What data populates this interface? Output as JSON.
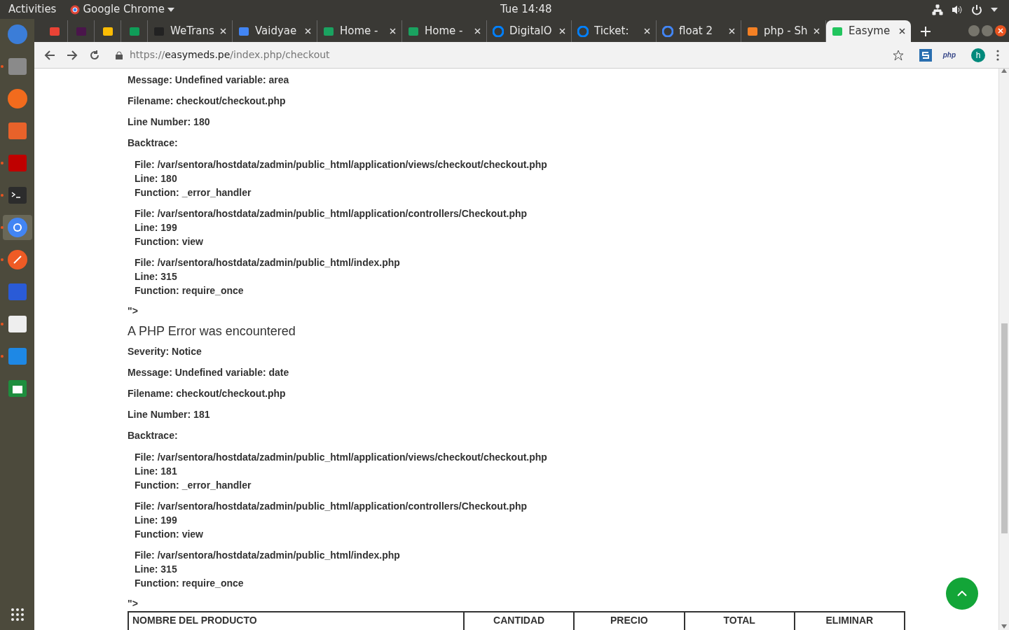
{
  "topbar": {
    "activities": "Activities",
    "app": "Google Chrome",
    "clock": "Tue 14:48"
  },
  "dock": [
    {
      "kind": "mail",
      "running": false,
      "selected": false
    },
    {
      "kind": "files",
      "running": true,
      "selected": false
    },
    {
      "kind": "firefox",
      "running": false,
      "selected": false
    },
    {
      "kind": "store",
      "running": false,
      "selected": false
    },
    {
      "kind": "filezilla",
      "running": true,
      "selected": false
    },
    {
      "kind": "terminal",
      "running": true,
      "selected": false
    },
    {
      "kind": "chrome",
      "running": true,
      "selected": true
    },
    {
      "kind": "postman",
      "running": true,
      "selected": false
    },
    {
      "kind": "remote",
      "running": false,
      "selected": false
    },
    {
      "kind": "editor",
      "running": true,
      "selected": false
    },
    {
      "kind": "vscode",
      "running": true,
      "selected": false
    },
    {
      "kind": "sheet",
      "running": false,
      "selected": false
    }
  ],
  "tabs": [
    {
      "kind": "gmail",
      "selected": false
    },
    {
      "kind": "slack",
      "selected": false
    },
    {
      "kind": "drive",
      "selected": false
    },
    {
      "kind": "sheets",
      "selected": false
    },
    {
      "kind": "we",
      "title": "WeTrans",
      "selected": false
    },
    {
      "kind": "docs",
      "title": "Vaidyae",
      "selected": false
    },
    {
      "kind": "home",
      "title": "Home -",
      "selected": false
    },
    {
      "kind": "home",
      "title": "Home -",
      "selected": false
    },
    {
      "kind": "do",
      "title": "DigitalO",
      "selected": false
    },
    {
      "kind": "do",
      "title": "Ticket:",
      "selected": false
    },
    {
      "kind": "google",
      "title": "float 2",
      "selected": false
    },
    {
      "kind": "so",
      "title": "php - Sh",
      "selected": false
    },
    {
      "kind": "easy",
      "title": "Easyme",
      "selected": true
    }
  ],
  "address": {
    "scheme": "https://",
    "host": "easymeds.pe",
    "path": "/index.php/checkout"
  },
  "extensions": {
    "php": "php",
    "avatar": "h"
  },
  "errors": [
    {
      "fields": [
        "Message: Undefined variable: area",
        "Filename: checkout/checkout.php",
        "Line Number: 180"
      ],
      "backtrace_label": "Backtrace:",
      "backtrace": [
        [
          "File: /var/sentora/hostdata/zadmin/public_html/application/views/checkout/checkout.php",
          "Line: 180",
          "Function: _error_handler"
        ],
        [
          "File: /var/sentora/hostdata/zadmin/public_html/application/controllers/Checkout.php",
          "Line: 199",
          "Function: view"
        ],
        [
          "File: /var/sentora/hostdata/zadmin/public_html/index.php",
          "Line: 315",
          "Function: require_once"
        ]
      ],
      "tail": "\">"
    },
    {
      "title": "A PHP Error was encountered",
      "fields": [
        "Severity: Notice",
        "Message: Undefined variable: date",
        "Filename: checkout/checkout.php",
        "Line Number: 181"
      ],
      "backtrace_label": "Backtrace:",
      "backtrace": [
        [
          "File: /var/sentora/hostdata/zadmin/public_html/application/views/checkout/checkout.php",
          "Line: 181",
          "Function: _error_handler"
        ],
        [
          "File: /var/sentora/hostdata/zadmin/public_html/application/controllers/Checkout.php",
          "Line: 199",
          "Function: view"
        ],
        [
          "File: /var/sentora/hostdata/zadmin/public_html/index.php",
          "Line: 315",
          "Function: require_once"
        ]
      ],
      "tail": "\">"
    }
  ],
  "table": {
    "columns": [
      "NOMBRE DEL PRODUCTO",
      "CANTIDAD",
      "PRECIO",
      "TOTAL",
      "ELIMINAR"
    ]
  }
}
